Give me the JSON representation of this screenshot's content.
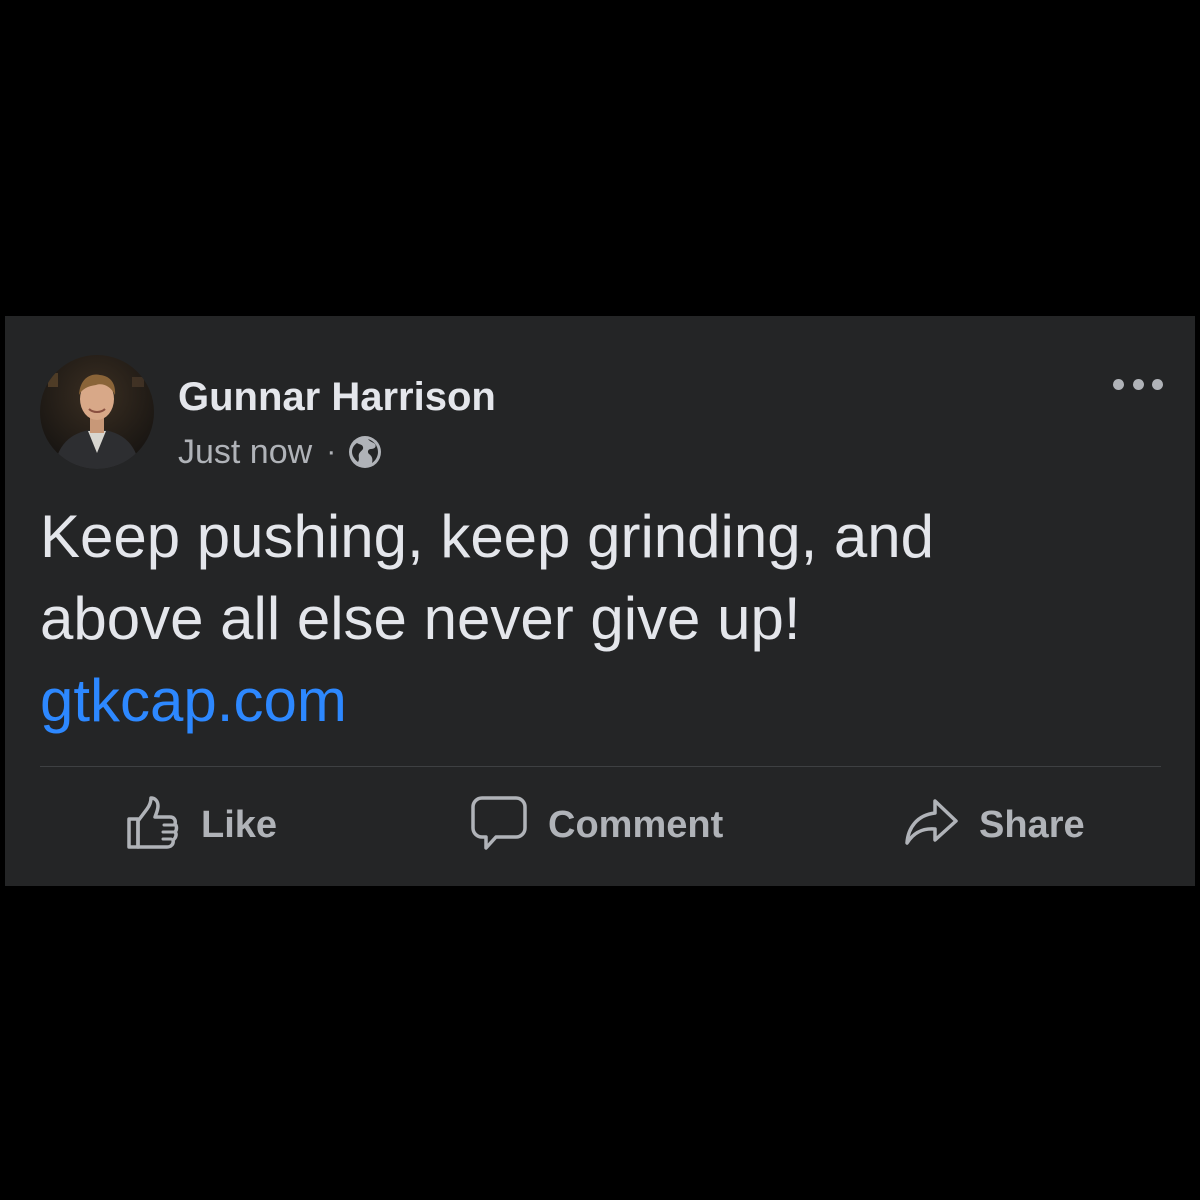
{
  "post": {
    "author": "Gunnar Harrison",
    "timestamp": "Just now",
    "separator": "·",
    "privacy_icon": "globe-icon",
    "text_lines": [
      "Keep pushing, keep grinding, and",
      "above all else never give up!"
    ],
    "link": "gtkcap.com"
  },
  "actions": {
    "like": {
      "label": "Like",
      "icon": "thumbs-up-icon"
    },
    "comment": {
      "label": "Comment",
      "icon": "speech-bubble-icon"
    },
    "share": {
      "label": "Share",
      "icon": "share-arrow-icon"
    }
  },
  "menu": {
    "icon": "more-options-icon"
  },
  "colors": {
    "page_background": "#000000",
    "card_background": "#242526",
    "primary_text": "#e4e6eb",
    "secondary_text": "#b0b3b8",
    "link": "#2d88ff",
    "divider": "#3e4042"
  }
}
